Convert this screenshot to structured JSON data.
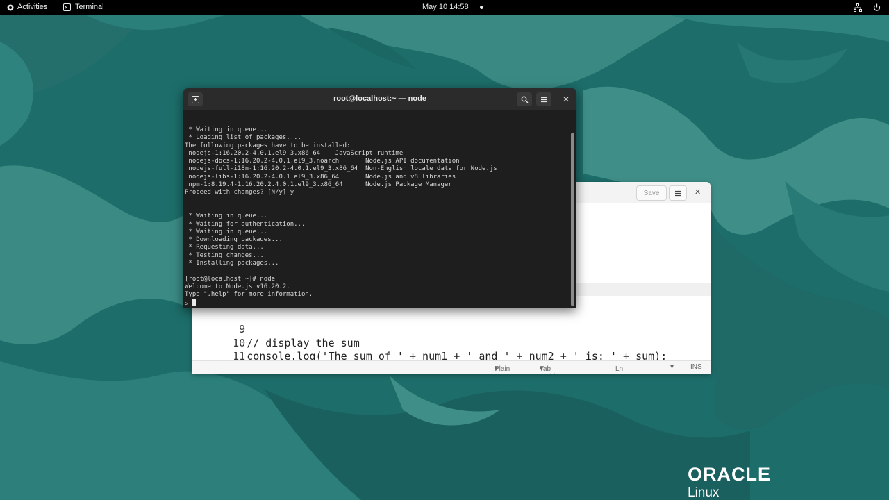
{
  "topbar": {
    "activities_label": "Activities",
    "app_label": "Terminal",
    "clock": "May 10  14:58"
  },
  "terminal": {
    "title": "root@localhost:~ — node",
    "lines": [
      " * Waiting in queue...",
      " * Loading list of packages....",
      "The following packages have to be installed:",
      " nodejs-1:16.20.2-4.0.1.el9_3.x86_64    JavaScript runtime",
      " nodejs-docs-1:16.20.2-4.0.1.el9_3.noarch       Node.js API documentation",
      " nodejs-full-i18n-1:16.20.2-4.0.1.el9_3.x86_64  Non-English locale data for Node.js",
      " nodejs-libs-1:16.20.2-4.0.1.el9_3.x86_64       Node.js and v8 libraries",
      " npm-1:8.19.4-1.16.20.2.4.0.1.el9_3.x86_64      Node.js Package Manager",
      "Proceed with changes? [N/y] y",
      "",
      "",
      " * Waiting in queue...",
      " * Waiting for authentication...",
      " * Waiting in queue...",
      " * Downloading packages...",
      " * Requesting data...",
      " * Testing changes...",
      " * Installing packages...",
      "",
      "[root@localhost ~]# node",
      "Welcome to Node.js v16.20.2.",
      "Type \".help\" for more information."
    ],
    "prompt": "> "
  },
  "editor": {
    "save_label": "Save",
    "code_lines": [
      {
        "num": "9",
        "text": ""
      },
      {
        "num": "10",
        "text": "// display the sum"
      },
      {
        "num": "11",
        "text": "console.log('The sum of ' + num1 + ' and ' + num2 + ' is: ' + sum);"
      }
    ],
    "status": {
      "language": "Plain Text",
      "tab_width": "Tab Width: 8",
      "position": "Ln 7, Col 19",
      "mode": "INS"
    }
  },
  "branding": {
    "line1": "ORACLE",
    "line2": "Linux"
  },
  "colors": {
    "desktop": "#1d6d6a",
    "terminal_bg": "#1e1e1e",
    "topbar_bg": "#000000"
  }
}
